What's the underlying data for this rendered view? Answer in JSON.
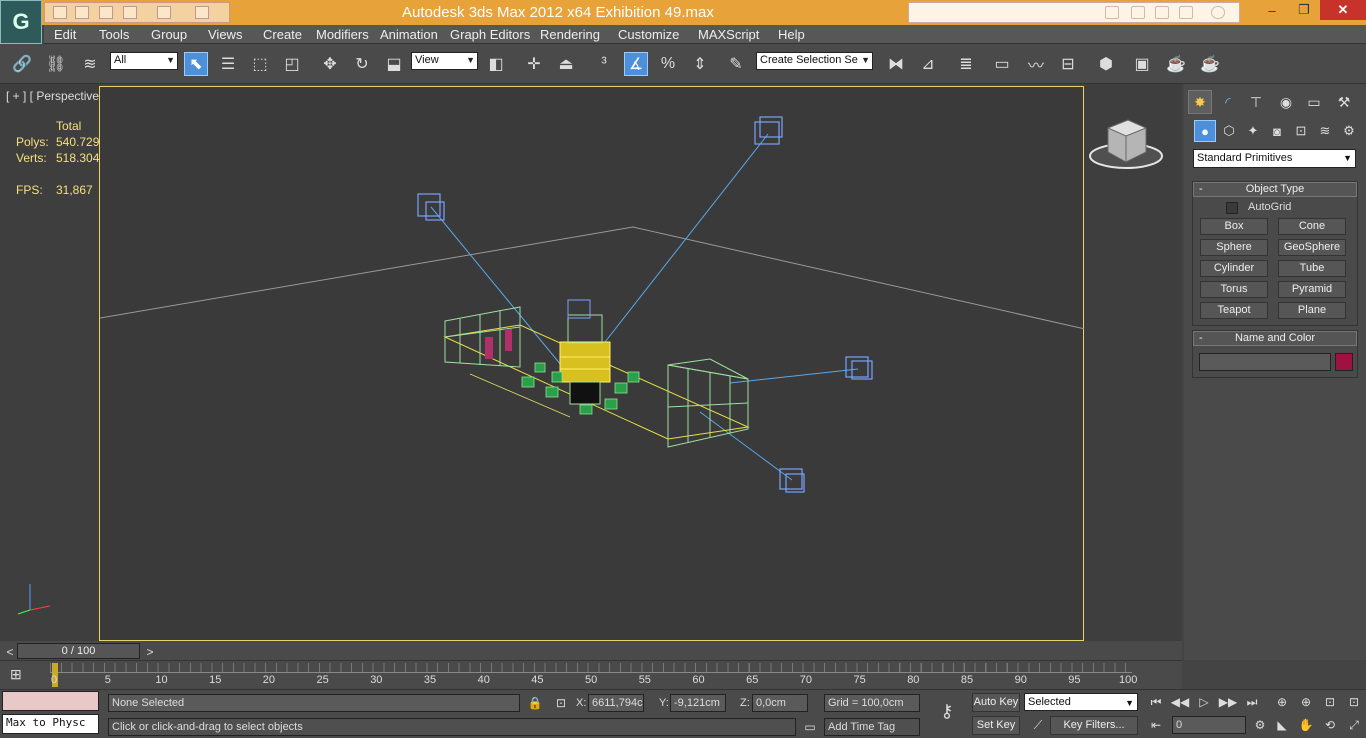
{
  "window": {
    "title": "Autodesk 3ds Max  2012 x64      Exhibition 49.max",
    "app_icon": "3ds-max-logo-icon",
    "minimize": "–",
    "maximize": "❐",
    "close": "✕"
  },
  "menu": [
    "Edit",
    "Tools",
    "Group",
    "Views",
    "Create",
    "Modifiers",
    "Animation",
    "Graph Editors",
    "Rendering",
    "Customize",
    "MAXScript",
    "Help"
  ],
  "toolbar": {
    "filter": "All",
    "ref_coord": "View",
    "selection_set": "Create Selection Se"
  },
  "viewport": {
    "label": "[ + ] [ Perspective ] [ Wireframe ]",
    "stats": {
      "header": "Total",
      "polys_label": "Polys:",
      "polys": "540.729",
      "verts_label": "Verts:",
      "verts": "518.304",
      "fps_label": "FPS:",
      "fps": "31,867"
    },
    "accent_color": "#e8d36a"
  },
  "command_panel": {
    "category": "Standard Primitives",
    "object_type": {
      "title": "Object Type",
      "autogrid": "AutoGrid",
      "buttons": [
        "Box",
        "Cone",
        "Sphere",
        "GeoSphere",
        "Cylinder",
        "Tube",
        "Torus",
        "Pyramid",
        "Teapot",
        "Plane"
      ]
    },
    "name_color": {
      "title": "Name and Color",
      "name_value": "",
      "swatch_color": "#a01040"
    }
  },
  "timeline": {
    "slider": "0 / 100",
    "ticks": [
      "0",
      "5",
      "10",
      "15",
      "20",
      "25",
      "30",
      "35",
      "40",
      "45",
      "50",
      "55",
      "60",
      "65",
      "70",
      "75",
      "80",
      "85",
      "90",
      "95",
      "100"
    ]
  },
  "status": {
    "maxscript": "Max to Physc",
    "selection": "None Selected",
    "prompt": "Click or click-and-drag to select objects",
    "x_label": "X:",
    "x": "6611,794c",
    "y_label": "Y:",
    "y": "-9,121cm",
    "z_label": "Z:",
    "z": "0,0cm",
    "grid": "Grid = 100,0cm",
    "add_time_tag": "Add Time Tag",
    "auto_key": "Auto Key",
    "set_key": "Set Key",
    "key_mode": "Selected",
    "key_filters": "Key Filters...",
    "frame": "0"
  }
}
